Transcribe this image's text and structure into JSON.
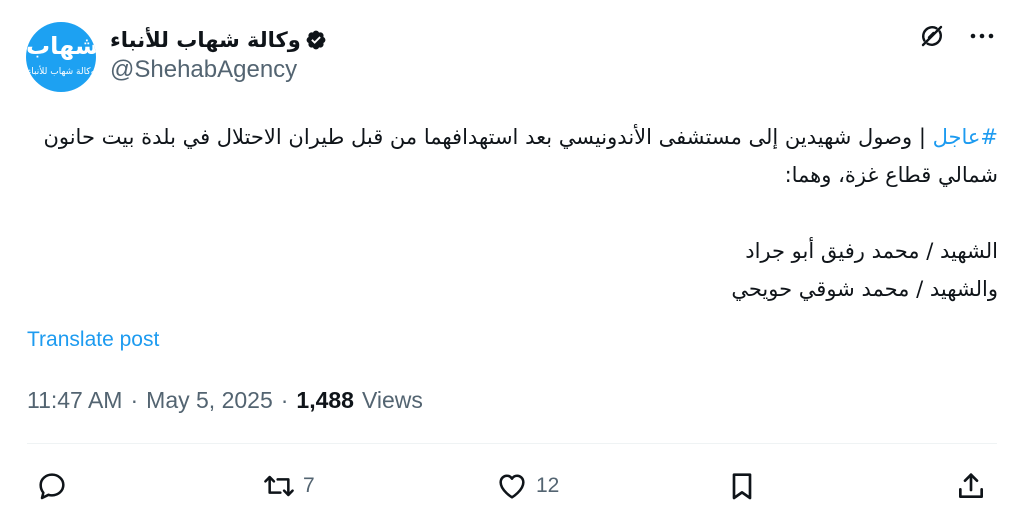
{
  "author": {
    "avatar_text": "شهاب",
    "avatar_subtext": "وكالة شهاب للأنباء",
    "display_name": "وكالة شهاب للأنباء",
    "handle": "@ShehabAgency",
    "verified": true
  },
  "tweet": {
    "hashtag": "#عاجل",
    "line1": " | وصول شهيدين إلى مستشفى الأندونيسي بعد استهدافهما من قبل طيران الاحتلال في بلدة بيت حانون شمالي قطاع غزة، وهما:",
    "line3": "الشهيد / محمد رفيق أبو جراد",
    "line4": "والشهيد / محمد شوقي حويحي"
  },
  "translate_label": "Translate post",
  "meta": {
    "time": "11:47 AM",
    "sep1": "·",
    "date": "May 5, 2025",
    "sep2": "·",
    "views_count": "1,488",
    "views_label": "Views"
  },
  "actions": {
    "reply_count": "",
    "retweet_count": "7",
    "like_count": "12"
  },
  "icons": [
    "grok-icon",
    "more-icon",
    "reply-icon",
    "retweet-icon",
    "like-icon",
    "bookmark-icon",
    "share-icon"
  ],
  "colors": {
    "accent": "#1d9bf0",
    "text": "#0f1419",
    "muted": "#536471"
  }
}
